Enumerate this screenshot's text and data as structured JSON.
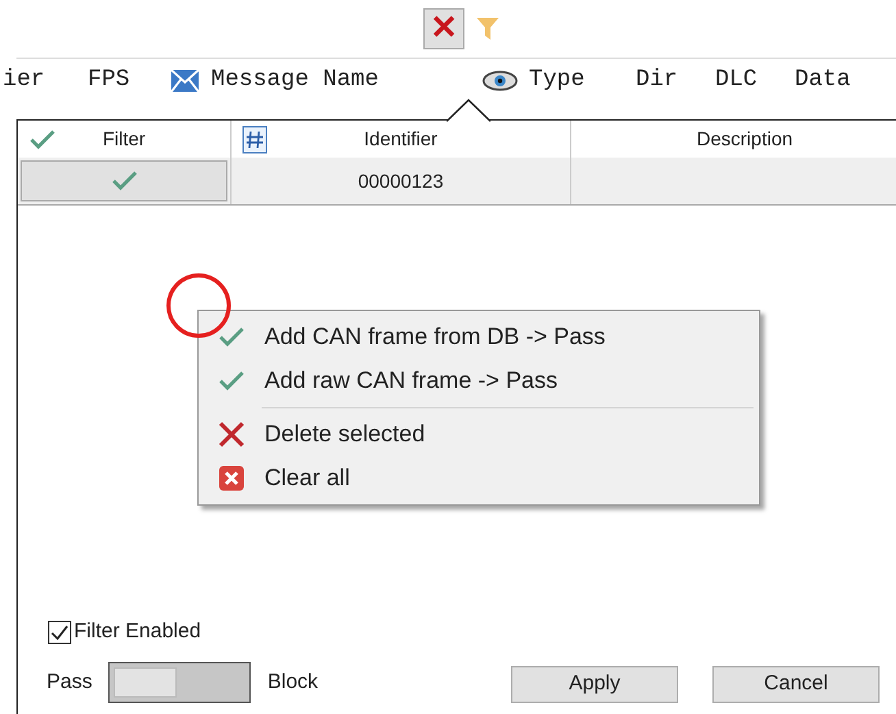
{
  "toolbar": {
    "close_label": "✕"
  },
  "grid": {
    "columns": [
      {
        "label": "ier"
      },
      {
        "label": "FPS"
      },
      {
        "label": "Message Name"
      },
      {
        "label": "Type"
      },
      {
        "label": "Dir"
      },
      {
        "label": "DLC"
      },
      {
        "label": "Data"
      }
    ]
  },
  "filter_table": {
    "columns": [
      {
        "label": "Filter"
      },
      {
        "label": "Identifier"
      },
      {
        "label": "Description"
      }
    ],
    "rows": [
      {
        "checked": true,
        "identifier": "00000123"
      }
    ]
  },
  "context_menu": [
    {
      "kind": "check",
      "label": "Add CAN frame from DB -> Pass"
    },
    {
      "kind": "check",
      "label": "Add raw CAN frame -> Pass"
    },
    {
      "kind": "separator"
    },
    {
      "kind": "delete",
      "label": "Delete selected"
    },
    {
      "kind": "clear",
      "label": "Clear all"
    }
  ],
  "filter_enabled": {
    "label": "Filter Enabled",
    "checked": true
  },
  "mode_switch": {
    "left_label": "Pass",
    "right_label": "Block",
    "on": false
  },
  "buttons": [
    {
      "label": "Apply"
    },
    {
      "label": "Cancel"
    }
  ]
}
